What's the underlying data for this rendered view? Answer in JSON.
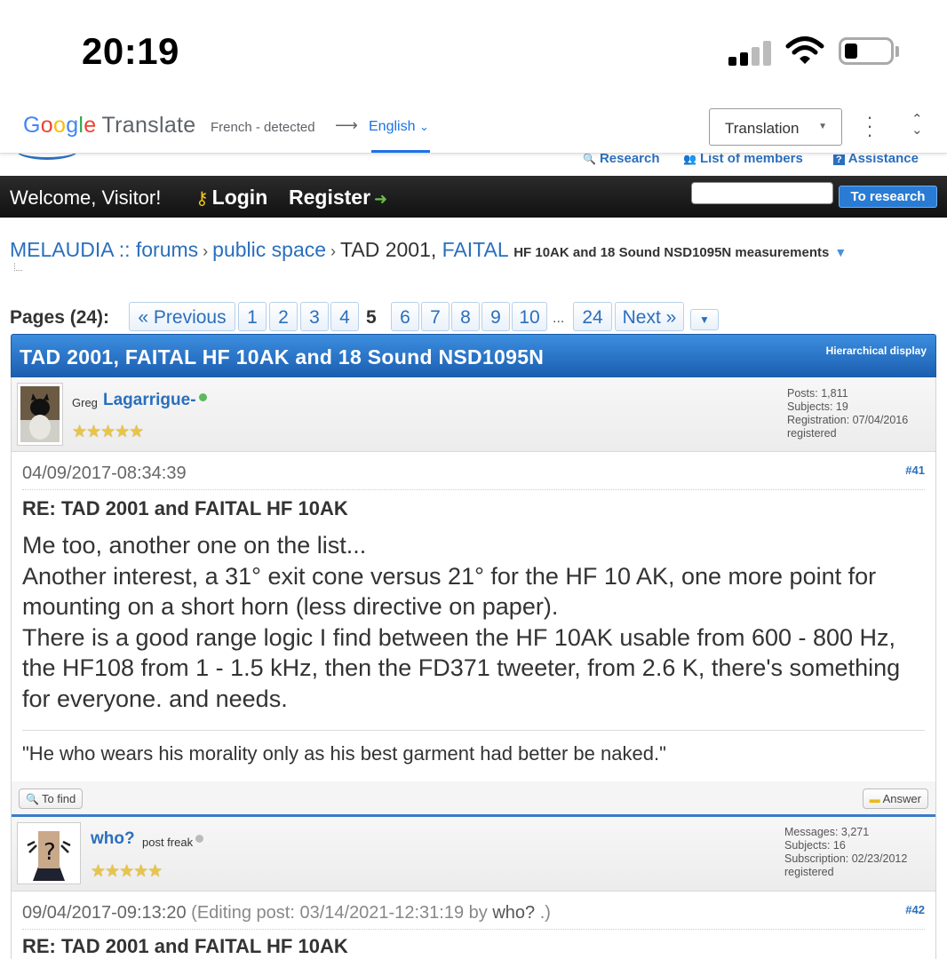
{
  "status_bar": {
    "time": "20:19",
    "signal_icon": "cellular-signal-icon",
    "wifi_icon": "wifi-icon",
    "battery_icon": "battery-icon"
  },
  "translate_bar": {
    "logo_google": "Google",
    "logo_translate": "Translate",
    "source_language": "French - detected",
    "arrow": "⟶",
    "target_language": "English",
    "mode_select": "Translation",
    "accent_color": "#1a73e8"
  },
  "header": {
    "links": [
      {
        "label": "Research",
        "icon": "magnifier-icon"
      },
      {
        "label": "List of members",
        "icon": "members-icon"
      },
      {
        "label": "Assistance",
        "icon": "help-icon"
      }
    ],
    "welcome": "Welcome, Visitor!",
    "login": "Login",
    "register": "Register",
    "search_button": "To research",
    "search_placeholder": ""
  },
  "breadcrumb": {
    "items": [
      "MELAUDIA :: forums",
      "public space"
    ],
    "current_prefix": "TAD 2001,",
    "current_link": "FAITAL",
    "current_tail": "HF 10AK and 18 Sound NSD1095N measurements"
  },
  "pagination": {
    "label": "Pages (24):",
    "previous": "« Previous",
    "pages_before": [
      "1",
      "2",
      "3",
      "4"
    ],
    "current": "5",
    "pages_after": [
      "6",
      "7",
      "8",
      "9",
      "10"
    ],
    "ellipsis": "...",
    "last": "24",
    "next": "Next »"
  },
  "topic": {
    "title": "TAD 2001, FAITAL HF 10AK and 18 Sound NSD1095N",
    "display_mode": "Hierarchical display",
    "brand_color": "#2a6fbd"
  },
  "posts": [
    {
      "author_prefix": "Greg",
      "author_name": "Lagarrigue-",
      "online": true,
      "rank": "",
      "stars": "★★★★★",
      "stats": [
        "Posts: 1,811",
        "Subjects: 19",
        "Registration: 07/04/2016",
        "registered"
      ],
      "date": "04/09/2017-08:34:39",
      "number": "#41",
      "subject": "RE: TAD 2001 and FAITAL HF 10AK",
      "body": [
        "Me too, another one on the list...",
        "Another interest, a 31° exit cone versus 21° for the HF 10 AK, one more point for mounting on a short horn (less directive on paper).",
        "There is a good range logic I find between the HF 10AK usable from 600 - 800 Hz, the HF108 from 1 - 1.5 kHz, then the FD371 tweeter, from 2.6 K, there's something for everyone. and needs."
      ],
      "signature": "\"He who wears his morality only as his best garment had better be naked.\"",
      "find_button": "To find",
      "answer_button": "Answer"
    },
    {
      "author_name": "who?",
      "rank": "post freak",
      "online": false,
      "stars": "★★★★★",
      "stats": [
        "Messages: 3,271",
        "Subjects: 16",
        "Subscription: 02/23/2012",
        "registered"
      ],
      "date": "09/04/2017-09:13:20",
      "edit_note": "(Editing post: 03/14/2021-12:31:19 by",
      "edit_by": "who?",
      "edit_end": ".)",
      "number": "#42",
      "subject": "RE: TAD 2001 and FAITAL HF 10AK"
    }
  ]
}
